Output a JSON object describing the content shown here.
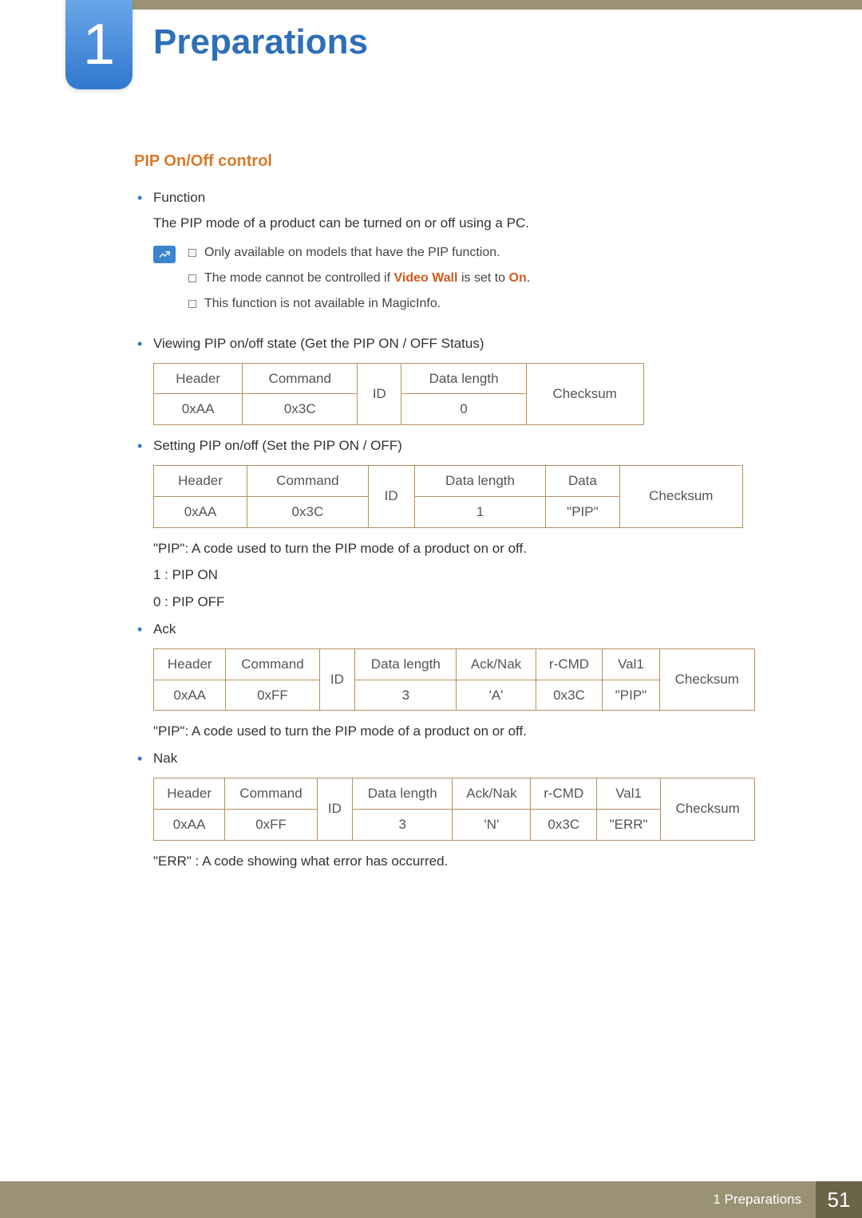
{
  "chapter": {
    "number": "1",
    "title": "Preparations"
  },
  "section": {
    "title": "PIP On/Off control"
  },
  "items": {
    "function": {
      "label": "Function",
      "desc": "The PIP mode of a product can be turned on or off using a PC."
    },
    "notes": {
      "n1": "Only available on models that have the PIP function.",
      "n2a": "The mode cannot be controlled if ",
      "n2_vw": "Video Wall",
      "n2b": " is set to ",
      "n2_on": "On",
      "n2c": ".",
      "n3": "This function is not available in MagicInfo."
    },
    "viewing": {
      "label": "Viewing PIP on/off state (Get the PIP ON / OFF Status)",
      "table": {
        "h1": "Header",
        "h2": "Command",
        "h3": "ID",
        "h4": "Data length",
        "h5": "Checksum",
        "v1": "0xAA",
        "v2": "0x3C",
        "v4": "0"
      }
    },
    "setting": {
      "label": "Setting PIP on/off (Set the PIP ON / OFF)",
      "table": {
        "h1": "Header",
        "h2": "Command",
        "h3": "ID",
        "h4": "Data length",
        "h5": "Data",
        "h6": "Checksum",
        "v1": "0xAA",
        "v2": "0x3C",
        "v4": "1",
        "v5": "\"PIP\""
      },
      "note1": "\"PIP\": A code used to turn the PIP mode of a product on or off.",
      "note2": "1 : PIP ON",
      "note3": "0 : PIP OFF"
    },
    "ack": {
      "label": "Ack",
      "table": {
        "h1": "Header",
        "h2": "Command",
        "h3": "ID",
        "h4": "Data length",
        "h5": "Ack/Nak",
        "h6": "r-CMD",
        "h7": "Val1",
        "h8": "Checksum",
        "v1": "0xAA",
        "v2": "0xFF",
        "v4": "3",
        "v5": "'A'",
        "v6": "0x3C",
        "v7": "\"PIP\""
      },
      "note": "\"PIP\": A code used to turn the PIP mode of a product on or off."
    },
    "nak": {
      "label": "Nak",
      "table": {
        "h1": "Header",
        "h2": "Command",
        "h3": "ID",
        "h4": "Data length",
        "h5": "Ack/Nak",
        "h6": "r-CMD",
        "h7": "Val1",
        "h8": "Checksum",
        "v1": "0xAA",
        "v2": "0xFF",
        "v4": "3",
        "v5": "'N'",
        "v6": "0x3C",
        "v7": "\"ERR\""
      },
      "note": "\"ERR\" : A code showing what error has occurred."
    }
  },
  "footer": {
    "label": "1 Preparations",
    "page": "51"
  }
}
